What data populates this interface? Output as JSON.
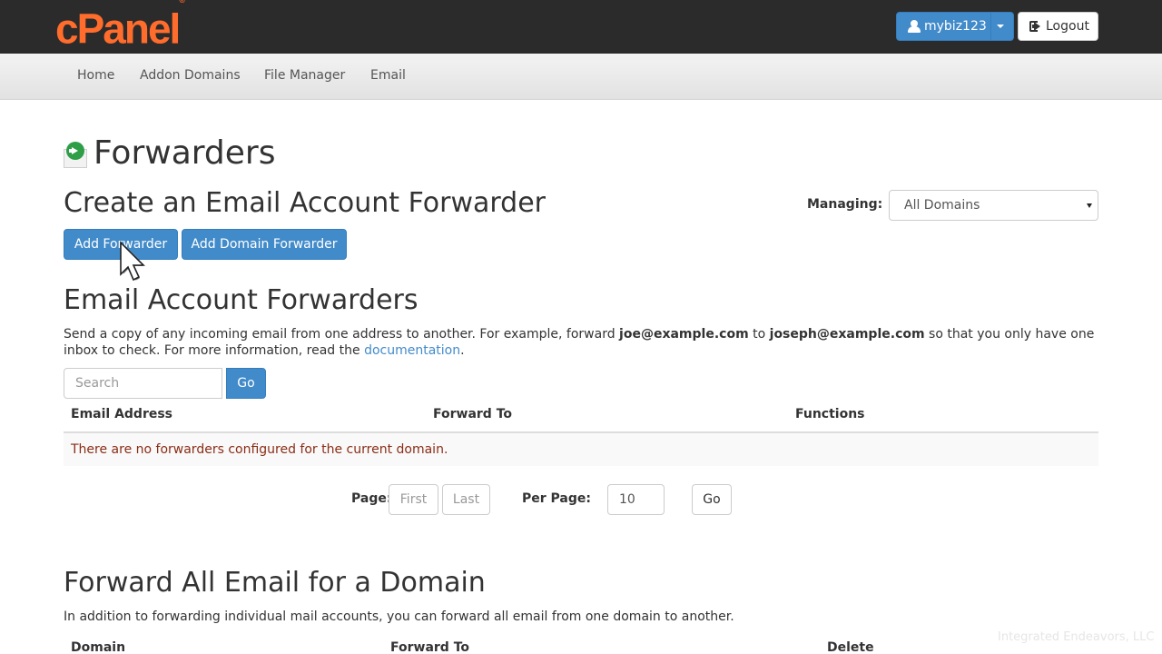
{
  "header": {
    "logo": "cPanel",
    "logo_mark": "®",
    "username": "mybiz123",
    "logout_label": "Logout"
  },
  "nav": {
    "items": [
      {
        "label": "Home"
      },
      {
        "label": "Addon Domains"
      },
      {
        "label": "File Manager"
      },
      {
        "label": "Email"
      }
    ]
  },
  "page": {
    "title": "Forwarders"
  },
  "create": {
    "heading": "Create an Email Account Forwarder",
    "managing_label": "Managing:",
    "managing_value": "All Domains",
    "add_forwarder_label": "Add Forwarder",
    "add_domain_forwarder_label": "Add Domain Forwarder"
  },
  "account_forwarders": {
    "heading": "Email Account Forwarders",
    "desc_part1": "Send a copy of any incoming email from one address to another. For example, forward ",
    "desc_email1": "joe@example.com",
    "desc_part2": " to ",
    "desc_email2": "joseph@example.com",
    "desc_part3": " so that you only have one inbox to check. For more information, read the ",
    "desc_link": "documentation",
    "desc_end": ".",
    "search_placeholder": "Search",
    "go_label": "Go",
    "columns": [
      "Email Address",
      "Forward To",
      "Functions"
    ],
    "empty_message": "There are no forwarders configured for the current domain.",
    "pager": {
      "page_label": "Page:",
      "first_label": "First",
      "last_label": "Last",
      "per_page_label": "Per Page:",
      "per_page_value": "10",
      "go_label": "Go"
    }
  },
  "domain_forwarders": {
    "heading": "Forward All Email for a Domain",
    "description": "In addition to forwarding individual mail accounts, you can forward all email from one domain to another.",
    "columns": [
      "Domain",
      "Forward To",
      "Delete"
    ]
  },
  "watermark": "Integrated Endeavors, LLC",
  "colors": {
    "brand": "#ff6c2c",
    "primary": "#428bca",
    "topbar": "#2b2b2b",
    "empty_text": "#8a2d16"
  },
  "icons": {
    "user": "user-icon",
    "logout": "logout-icon",
    "page": "forwarders-icon",
    "cursor": "mouse-cursor-icon"
  }
}
